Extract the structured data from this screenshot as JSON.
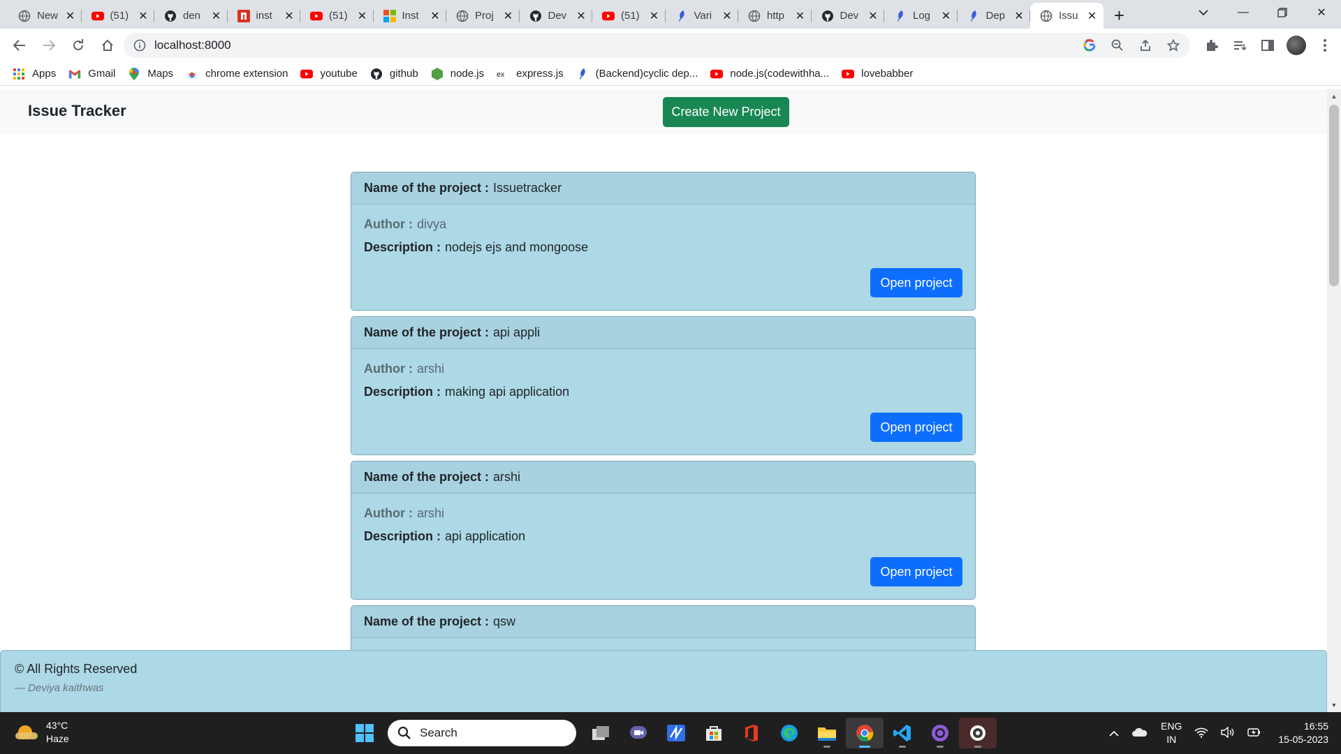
{
  "browser": {
    "tabs": [
      {
        "title": "New",
        "icon": "chrome-globe-icon"
      },
      {
        "title": "(51)",
        "icon": "youtube-icon"
      },
      {
        "title": "den",
        "icon": "github-icon"
      },
      {
        "title": "inst",
        "icon": "red-square-icon"
      },
      {
        "title": "(51)",
        "icon": "youtube-icon"
      },
      {
        "title": "Inst",
        "icon": "microsoft-icon"
      },
      {
        "title": "Proj",
        "icon": "globe-icon"
      },
      {
        "title": "Dev",
        "icon": "github-icon"
      },
      {
        "title": "(51)",
        "icon": "youtube-icon"
      },
      {
        "title": "Vari",
        "icon": "feather-icon"
      },
      {
        "title": "http",
        "icon": "globe-icon"
      },
      {
        "title": "Dev",
        "icon": "github-icon"
      },
      {
        "title": "Log",
        "icon": "feather-icon"
      },
      {
        "title": "Dep",
        "icon": "feather-icon"
      },
      {
        "title": "Issu",
        "icon": "globe-icon",
        "active": true
      }
    ],
    "url": "localhost:8000",
    "bookmarks": [
      {
        "label": "Apps",
        "icon": "apps-grid-icon"
      },
      {
        "label": "Gmail",
        "icon": "gmail-icon"
      },
      {
        "label": "Maps",
        "icon": "maps-pin-icon"
      },
      {
        "label": "chrome extension",
        "icon": "chrome-store-icon"
      },
      {
        "label": "youtube",
        "icon": "youtube-icon"
      },
      {
        "label": "github",
        "icon": "github-icon"
      },
      {
        "label": "node.js",
        "icon": "nodejs-icon"
      },
      {
        "label": "express.js",
        "icon": "express-icon"
      },
      {
        "label": "(Backend)cyclic dep...",
        "icon": "feather-icon"
      },
      {
        "label": "node.js(codewithha...",
        "icon": "youtube-icon"
      },
      {
        "label": "lovebabber",
        "icon": "youtube-icon"
      }
    ]
  },
  "app": {
    "brand": "Issue Tracker",
    "create_button": "Create New Project",
    "labels": {
      "name": "Name of the project :",
      "author": "Author :",
      "description": "Description :",
      "open": "Open project"
    },
    "projects": [
      {
        "name": "Issuetracker",
        "author": "divya",
        "description": "nodejs ejs and mongoose"
      },
      {
        "name": "api appli",
        "author": "arshi",
        "description": "making api application"
      },
      {
        "name": "arshi",
        "author": "arshi",
        "description": "api application"
      },
      {
        "name": "qsw",
        "author": "",
        "description": ""
      }
    ],
    "footer": {
      "copyright": "© All Rights Reserved",
      "signature": "— Deviya kaithwas"
    }
  },
  "taskbar": {
    "weather": {
      "temp": "43°C",
      "condition": "Haze"
    },
    "search_placeholder": "Search",
    "lang": {
      "line1": "ENG",
      "line2": "IN"
    },
    "time": "16:55",
    "date": "15-05-2023"
  },
  "colors": {
    "card_bg": "#add8e6",
    "create_button": "#198754",
    "open_button": "#0d6efd"
  }
}
